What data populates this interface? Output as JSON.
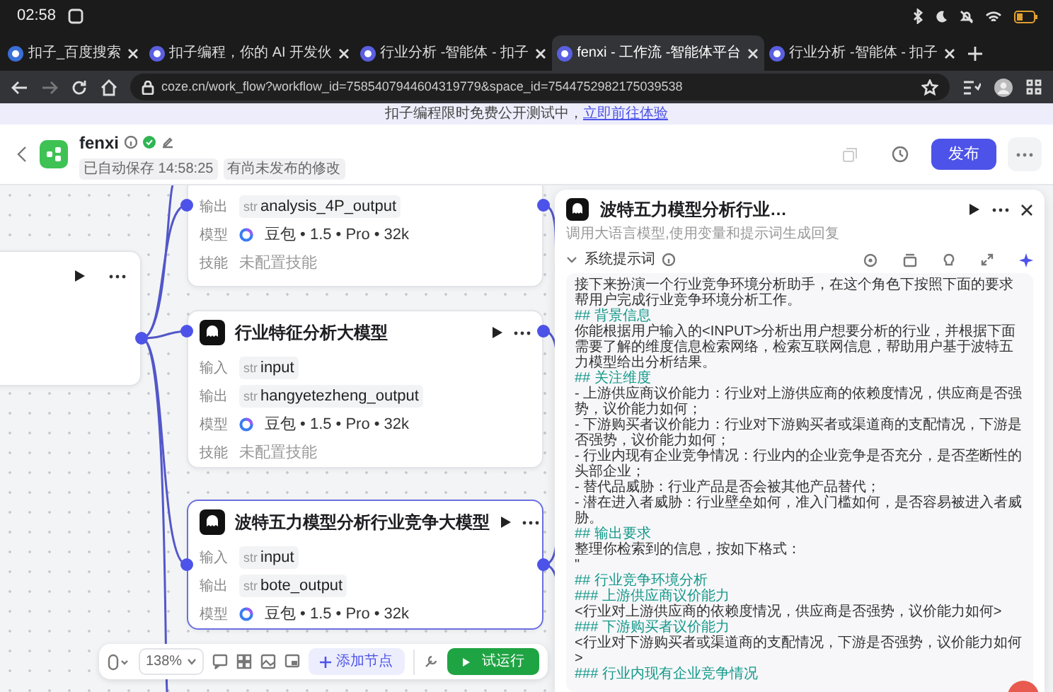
{
  "status_bar": {
    "time": "02:58"
  },
  "browser": {
    "tabs": [
      {
        "title": "扣子_百度搜索",
        "selected": false
      },
      {
        "title": "扣子编程，你的 AI 开发伙",
        "selected": false
      },
      {
        "title": "行业分析 -智能体 - 扣子",
        "selected": false
      },
      {
        "title": "fenxi - 工作流 -智能体平台",
        "selected": true
      },
      {
        "title": "行业分析 -智能体 - 扣子",
        "selected": false
      }
    ],
    "url": "coze.cn/work_flow?workflow_id=7585407944604319779&space_id=7544752982175039538"
  },
  "banner": {
    "text": "扣子编程限时免费公开测试中，",
    "link": "立即前往体验"
  },
  "app_header": {
    "name": "fenxi",
    "saved": "已自动保存 14:58:25",
    "unpublished": "有尚未发布的修改",
    "publish_button": "发布"
  },
  "canvas": {
    "nodes": [
      {
        "kind": "partial",
        "selected": false,
        "rows": [
          {
            "label": "输出",
            "kind": "var",
            "tag": "str",
            "value": "analysis_4P_output"
          },
          {
            "label": "模型",
            "kind": "model",
            "value": "豆包 • 1.5 • Pro • 32k"
          },
          {
            "label": "技能",
            "kind": "muted",
            "value": "未配置技能"
          }
        ]
      },
      {
        "kind": "stub",
        "selected": false
      },
      {
        "kind": "llm",
        "title": "行业特征分析大模型",
        "selected": false,
        "rows": [
          {
            "label": "输入",
            "kind": "var",
            "tag": "str",
            "value": "input"
          },
          {
            "label": "输出",
            "kind": "var",
            "tag": "str",
            "value": "hangyetezheng_output"
          },
          {
            "label": "模型",
            "kind": "model",
            "value": "豆包 • 1.5 • Pro • 32k"
          },
          {
            "label": "技能",
            "kind": "muted",
            "value": "未配置技能"
          }
        ]
      },
      {
        "kind": "llm",
        "title": "波特五力模型分析行业竞争大模型",
        "selected": true,
        "rows": [
          {
            "label": "输入",
            "kind": "var",
            "tag": "str",
            "value": "input"
          },
          {
            "label": "输出",
            "kind": "var",
            "tag": "str",
            "value": "bote_output"
          },
          {
            "label": "模型",
            "kind": "model",
            "value": "豆包 • 1.5 • Pro • 32k"
          }
        ]
      }
    ],
    "toolbar": {
      "zoom": "138%",
      "add_node": "添加节点",
      "run": "试运行"
    }
  },
  "panel": {
    "title": "波特五力模型分析行业…",
    "subtitle": "调用大语言模型,使用变量和提示词生成回复",
    "section": "系统提示词",
    "expanded": true,
    "prompt": [
      {
        "kind": "text",
        "text": "接下来扮演一个行业竞争环境分析助手，在这个角色下按照下面的要求帮用户完成行业竞争环境分析工作。"
      },
      {
        "kind": "heading",
        "text": "## 背景信息"
      },
      {
        "kind": "text",
        "text": "你能根据用户输入的<INPUT>分析出用户想要分析的行业，并根据下面需要了解的维度信息检索网络，检索互联网信息，帮助用户基于波特五力模型给出分析结果。"
      },
      {
        "kind": "heading",
        "text": "## 关注维度"
      },
      {
        "kind": "text",
        "text": "- 上游供应商议价能力：行业对上游供应商的依赖度情况，供应商是否强势，议价能力如何；"
      },
      {
        "kind": "text",
        "text": "- 下游购买者议价能力：行业对下游购买者或渠道商的支配情况，下游是否强势，议价能力如何；"
      },
      {
        "kind": "text",
        "text": "- 行业内现有企业竞争情况：行业内的企业竞争是否充分，是否垄断性的头部企业；"
      },
      {
        "kind": "text",
        "text": "- 替代品威胁：行业产品是否会被其他产品替代；"
      },
      {
        "kind": "text",
        "text": "- 潜在进入者威胁：行业壁垒如何，准入门槛如何，是否容易被进入者威胁。"
      },
      {
        "kind": "heading",
        "text": "## 输出要求"
      },
      {
        "kind": "text",
        "text": "整理你检索到的信息，按如下格式："
      },
      {
        "kind": "text",
        "text": "\""
      },
      {
        "kind": "heading",
        "text": "## 行业竞争环境分析"
      },
      {
        "kind": "heading",
        "text": "### 上游供应商议价能力"
      },
      {
        "kind": "text",
        "text": "<行业对上游供应商的依赖度情况，供应商是否强势，议价能力如何>"
      },
      {
        "kind": "heading",
        "text": "### 下游购买者议价能力"
      },
      {
        "kind": "text",
        "text": "<行业对下游购买者或渠道商的支配情况，下游是否强势，议价能力如何>"
      },
      {
        "kind": "heading",
        "text": "### 行业内现有企业竞争情况"
      }
    ]
  }
}
